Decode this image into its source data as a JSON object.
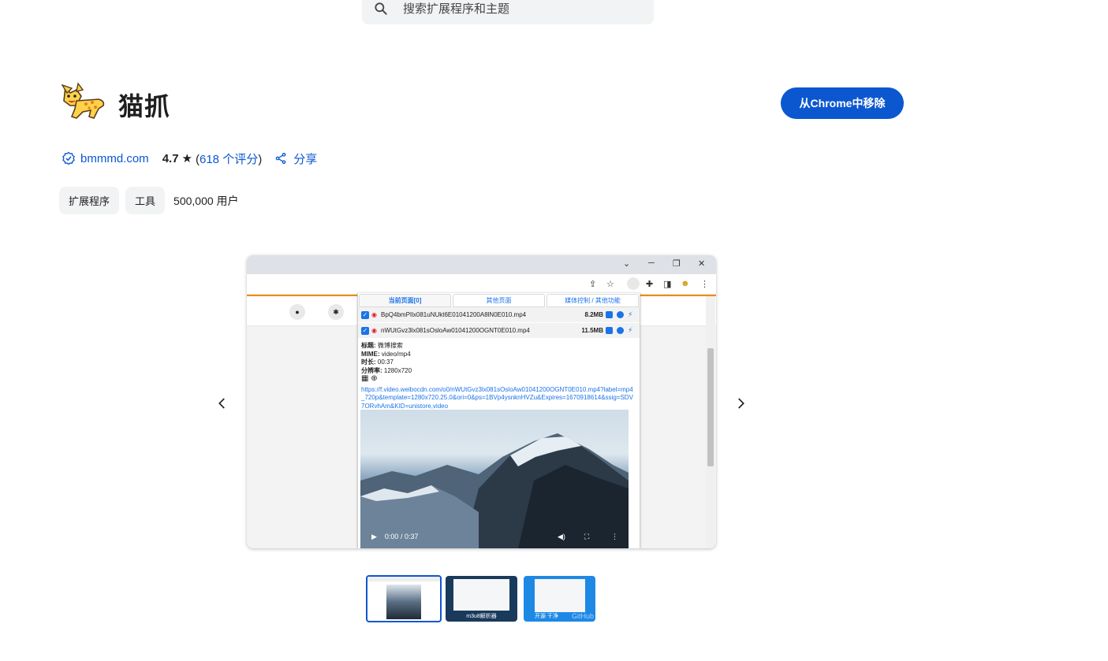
{
  "search": {
    "placeholder": "搜索扩展程序和主题"
  },
  "extension": {
    "name": "猫抓",
    "remove_button": "从Chrome中移除",
    "site": "bmmmd.com",
    "rating": "4.7",
    "rating_count": "618 个评分",
    "share_label": "分享",
    "chips": [
      "扩展程序",
      "工具"
    ],
    "users": "500,000 用户"
  },
  "screenshot": {
    "tabs": [
      "当前页面[0]",
      "其他页面",
      "媒体控制 / 其他功能"
    ],
    "rows": [
      {
        "name": "BpQ4bmPIlx081uNUkt6E01041200A8lN0E010.mp4",
        "size": "8.2MB"
      },
      {
        "name": "nWUtGvz3lx081sOsloAw01041200OGNT0E010.mp4",
        "size": "11.5MB"
      }
    ],
    "info": {
      "title_label": "标题:",
      "title_value": "微博搜索",
      "mime_label": "MIME:",
      "mime_value": "video/mp4",
      "duration_label": "时长:",
      "duration_value": "00:37",
      "resolution_label": "分辨率:",
      "resolution_value": "1280x720",
      "url": "https://f.video.weibocdn.com/o0/nWUtGvz3lx081sOsloAw01041200OGNT0E010.mp4?label=mp4_720p&template=1280x720.25.0&ori=0&ps=1BVp4ysnknHVZu&Expires=1670918614&ssig=SDV7ORvhAm&KID=unistore,video"
    },
    "video_time": "0:00 / 0:37"
  },
  "thumbnails": [
    {
      "label": ""
    },
    {
      "label": "m3u8解析器"
    },
    {
      "label": "开源 干净"
    }
  ],
  "thumbnail_watermark": "GitHub",
  "colors": {
    "accent": "#0b57d0",
    "chip_bg": "#f1f3f4"
  }
}
